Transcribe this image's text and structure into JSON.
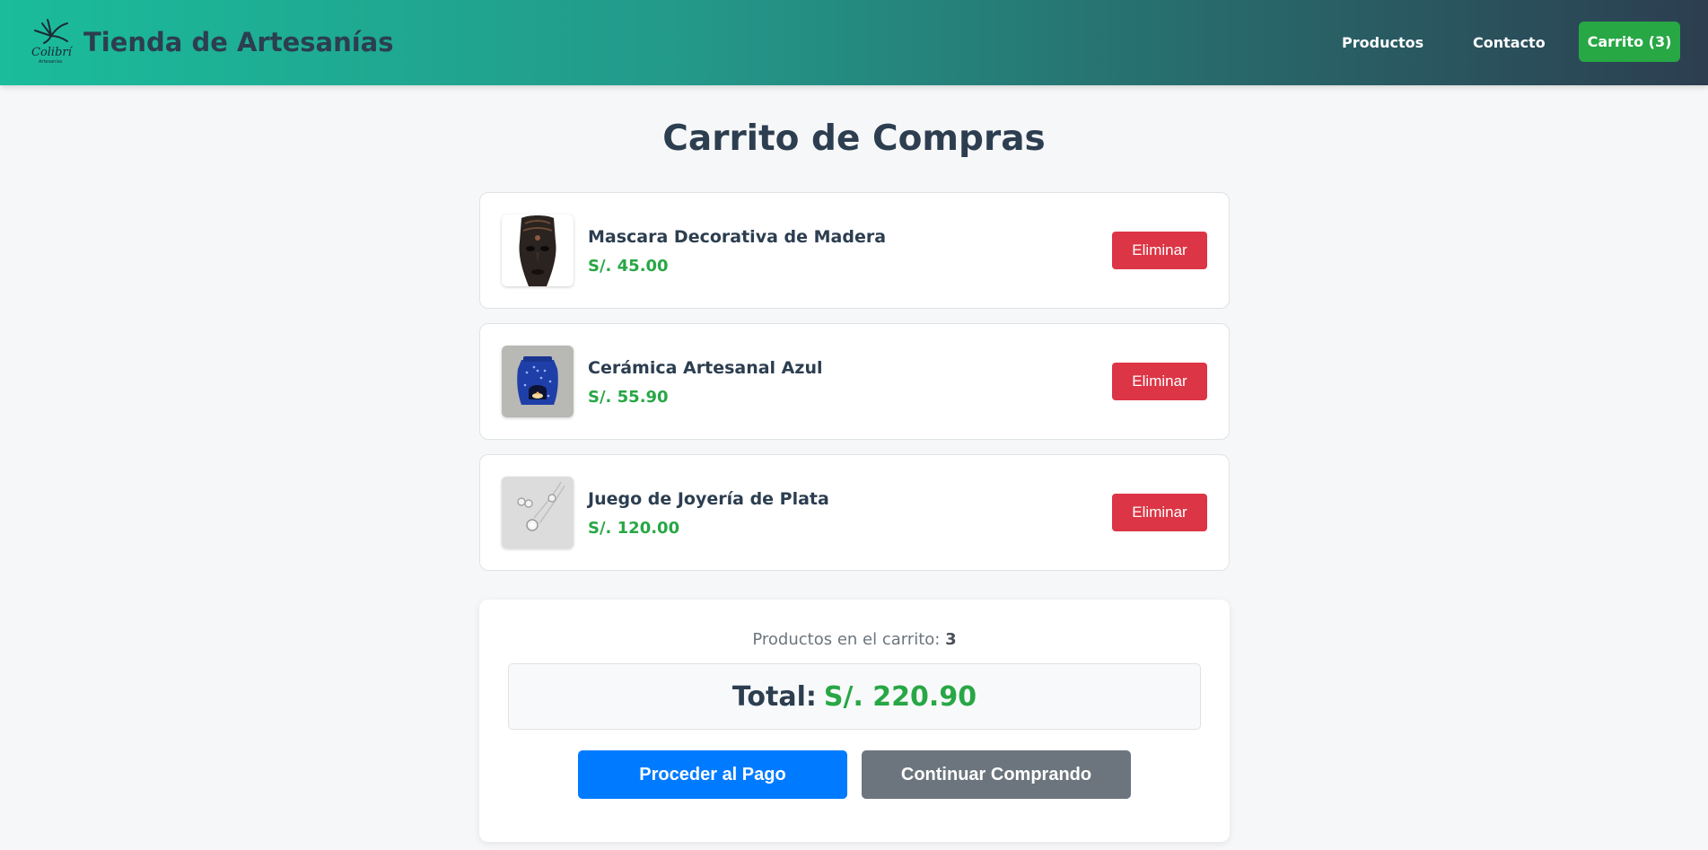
{
  "header": {
    "brand": "Tienda de Artesanías",
    "logo_text": "Colibrí",
    "logo_subtext": "Artesanías",
    "nav": [
      {
        "label": "Productos"
      },
      {
        "label": "Contacto"
      }
    ],
    "cart_label": "Carrito (3)"
  },
  "page": {
    "title": "Carrito de Compras"
  },
  "cart": {
    "items": [
      {
        "name": "Mascara Decorativa de Madera",
        "price": "S/. 45.00",
        "remove_label": "Eliminar",
        "image": "wooden-mask-image"
      },
      {
        "name": "Cerámica Artesanal Azul",
        "price": "S/. 55.90",
        "remove_label": "Eliminar",
        "image": "blue-ceramic-image"
      },
      {
        "name": "Juego de Joyería de Plata",
        "price": "S/. 120.00",
        "remove_label": "Eliminar",
        "image": "silver-jewelry-image"
      }
    ]
  },
  "summary": {
    "count_label": "Productos en el carrito:",
    "count": "3",
    "total_label": "Total:",
    "total_value": "S/. 220.90",
    "pay_button": "Proceder al Pago",
    "continue_button": "Continuar Comprando"
  },
  "colors": {
    "accent_green": "#28a745",
    "danger_red": "#dc3545",
    "primary_blue": "#007bff",
    "secondary_gray": "#6c757d",
    "header_start": "#1abc9c",
    "header_end": "#2c3e50"
  }
}
